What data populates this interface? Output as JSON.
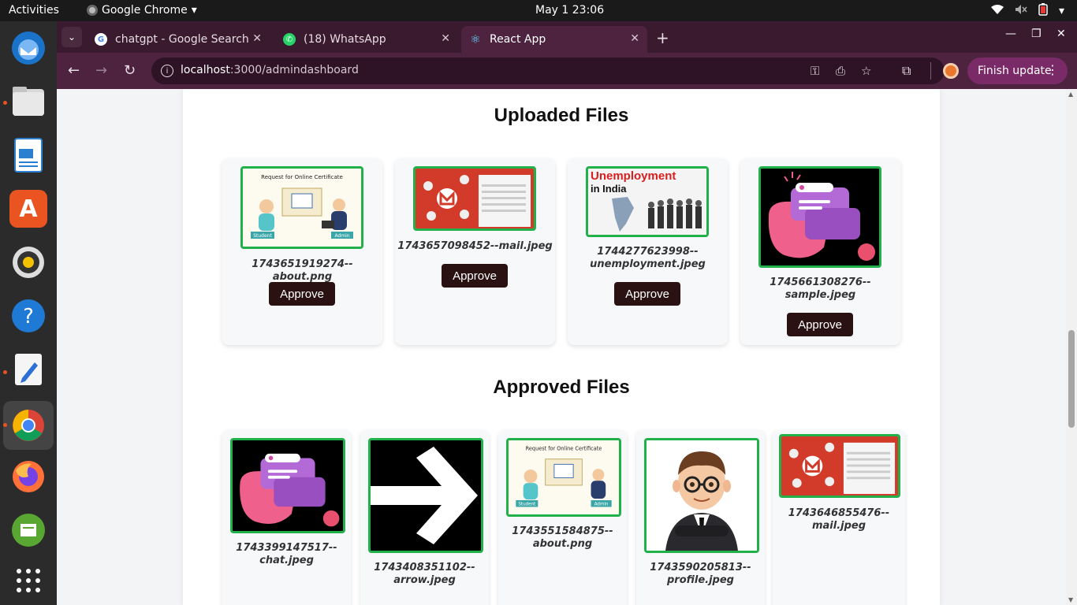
{
  "os": {
    "activities": "Activities",
    "app_name": "Google Chrome",
    "clock": "May 1  23:06"
  },
  "browser": {
    "tabs": [
      {
        "title": "chatgpt - Google Search",
        "icon": "google-icon"
      },
      {
        "title": "(18) WhatsApp",
        "icon": "whatsapp-icon"
      },
      {
        "title": "React App",
        "icon": "react-icon"
      }
    ],
    "url_host": "localhost",
    "url_path": ":3000/admindashboard",
    "finish_update": "Finish update"
  },
  "uploaded": {
    "title": "Uploaded Files",
    "files": [
      {
        "name": "1743651919274--about.png",
        "image": "certificate-illustration",
        "action": "Approve"
      },
      {
        "name": "1743657098452--mail.jpeg",
        "image": "gmail-screenshot",
        "action": "Approve"
      },
      {
        "name_line1": "1744277623998--",
        "name_line2": "unemployment.jpeg",
        "image": "unemployment-in-india",
        "image_text_1": "Unemployment",
        "image_text_2": "in India",
        "action": "Approve"
      },
      {
        "name_line1": "1745661308276--",
        "name_line2": "sample.jpeg",
        "image": "chat-bubbles-illustration",
        "action": "Approve"
      }
    ]
  },
  "approved": {
    "title": "Approved Files",
    "files": [
      {
        "name_line1": "1743399147517--",
        "name_line2": "chat.jpeg",
        "image": "chat-bubbles-illustration"
      },
      {
        "name_line1": "1743408351102--",
        "name_line2": "arrow.jpeg",
        "image": "arrow-right"
      },
      {
        "name_line1": "1743551584875--",
        "name_line2": "about.png",
        "image": "certificate-illustration"
      },
      {
        "name_line1": "1743590205813--",
        "name_line2": "profile.jpeg",
        "image": "cartoon-businessman"
      },
      {
        "name_line1": "1743646855476--",
        "name_line2": "mail.jpeg",
        "image": "gmail-screenshot"
      }
    ]
  },
  "certificate_text": {
    "title": "Request for Online Certificate",
    "student": "Student",
    "admin": "Admin"
  },
  "colors": {
    "approve_bg": "#2a1212",
    "thumb_border": "#22b04b",
    "chrome_frame": "#3a1a2e",
    "toolbar": "#4d2340"
  }
}
